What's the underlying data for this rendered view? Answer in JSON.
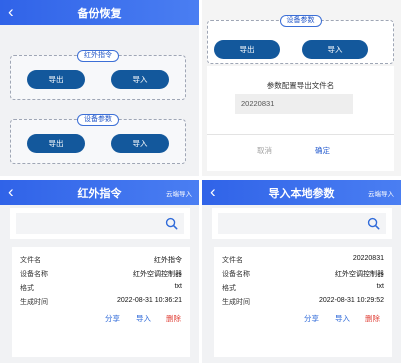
{
  "backup": {
    "title": "备份恢复",
    "ir_group": {
      "label": "红外指令",
      "export_label": "导出",
      "import_label": "导入"
    },
    "param_group": {
      "label": "设备参数",
      "export_label": "导出",
      "import_label": "导入"
    }
  },
  "export_dialog": {
    "group_label": "设备参数",
    "export_label": "导出",
    "import_label": "导入",
    "prompt": "参数配置导出文件名",
    "filename_value": "20220831",
    "cancel_label": "取消",
    "confirm_label": "确定"
  },
  "ir_screen": {
    "title": "红外指令",
    "right_action": "云端导入",
    "search_placeholder": "",
    "file": {
      "name_label": "文件名",
      "name_value": "红外指令",
      "device_label": "设备名称",
      "device_value": "红外空调控制器",
      "format_label": "格式",
      "format_value": "txt",
      "time_label": "生成时间",
      "time_value": "2022-08-31 10:36:21"
    },
    "actions": {
      "share": "分享",
      "import": "导入",
      "delete": "删除"
    }
  },
  "param_screen": {
    "title": "导入本地参数",
    "right_action": "云端导入",
    "search_placeholder": "",
    "file": {
      "name_label": "文件名",
      "name_value": "20220831",
      "device_label": "设备名称",
      "device_value": "红外空调控制器",
      "format_label": "格式",
      "format_value": "txt",
      "time_label": "生成时间",
      "time_value": "2022-08-31 10:29:52"
    },
    "actions": {
      "share": "分享",
      "import": "导入",
      "delete": "删除"
    }
  }
}
